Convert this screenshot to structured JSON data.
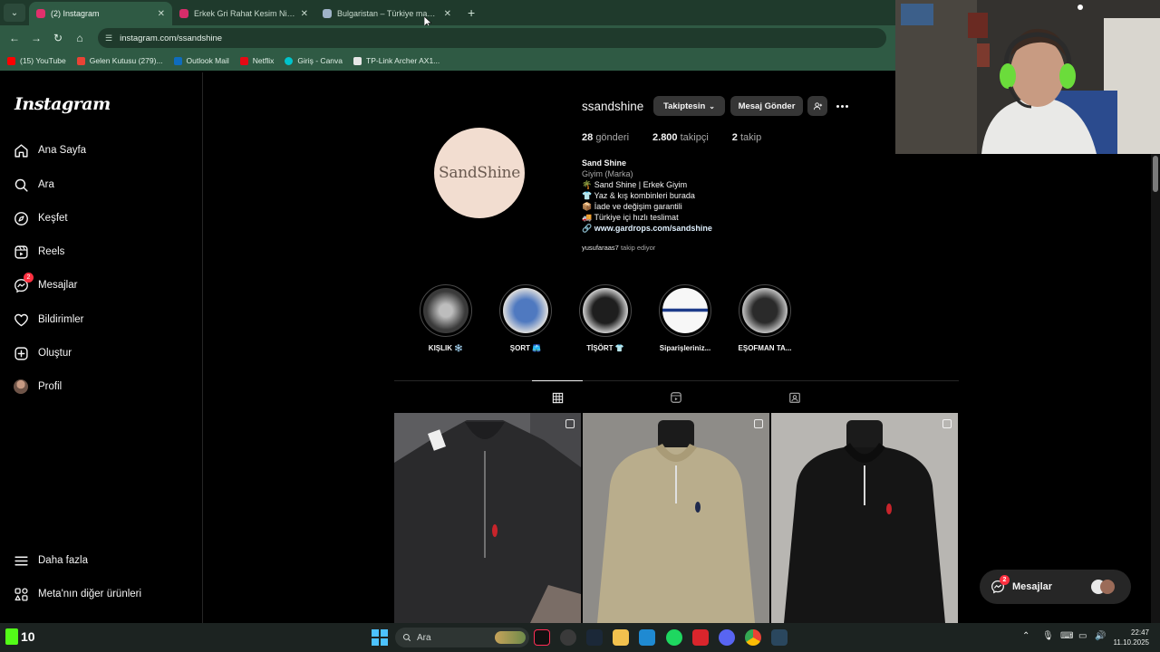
{
  "browser": {
    "tabs": [
      {
        "title": "(2) Instagram",
        "active": true,
        "favicon_color": "#e1306c"
      },
      {
        "title": "Erkek Gri Rahat Kesim Nike Eşo",
        "active": false,
        "favicon_color": "#d62d6a"
      },
      {
        "title": "Bulgaristan – Türkiye maçı canlı",
        "active": false,
        "favicon_color": "#9fb3c8"
      }
    ],
    "new_tab": "+",
    "url": "instagram.com/ssandshine",
    "bookmarks": [
      {
        "label": "(15) YouTube",
        "color": "#ff0000"
      },
      {
        "label": "Gelen Kutusu (279)...",
        "color": "#ea4335"
      },
      {
        "label": "Outlook Mail",
        "color": "#0f6cbd"
      },
      {
        "label": "Netflix",
        "color": "#e50914"
      },
      {
        "label": "Giriş - Canva",
        "color": "#00c4cc"
      },
      {
        "label": "TP-Link Archer AX1...",
        "color": "#e6e6e6"
      }
    ]
  },
  "sidebar": {
    "logo": "Instagram",
    "items": [
      {
        "label": "Ana Sayfa",
        "icon": "home-icon"
      },
      {
        "label": "Ara",
        "icon": "search-icon"
      },
      {
        "label": "Keşfet",
        "icon": "compass-icon"
      },
      {
        "label": "Reels",
        "icon": "reels-icon"
      },
      {
        "label": "Mesajlar",
        "icon": "messenger-icon",
        "badge": "2"
      },
      {
        "label": "Bildirimler",
        "icon": "heart-icon"
      },
      {
        "label": "Oluştur",
        "icon": "plus-square-icon"
      },
      {
        "label": "Profil",
        "icon": "avatar"
      }
    ],
    "more": "Daha fazla",
    "meta": "Meta'nın diğer ürünleri"
  },
  "profile": {
    "pic_text": "SandShine",
    "username": "ssandshine",
    "follow_button": "Takiptesin",
    "message_button": "Mesaj Gönder",
    "stats": {
      "posts_count": "28",
      "posts_label": "gönderi",
      "followers_count": "2.800",
      "followers_label": "takipçi",
      "following_count": "2",
      "following_label": "takip"
    },
    "bio": {
      "name": "Sand Shine",
      "category": "Giyim (Marka)",
      "lines": [
        "🌴 Sand Shine | Erkek Giyim",
        "👕 Yaz & kış kombinleri burada",
        "📦 İade ve değişim garantili",
        "🚚 Türkiye içi hızlı teslimat"
      ],
      "link": "🔗 www.gardrops.com/sandshine"
    },
    "followed_by_user": "yusufaraas7",
    "followed_by_text": "takip ediyor"
  },
  "highlights": [
    {
      "label": "KIŞLIK ❄️",
      "color": "#3a3a3a"
    },
    {
      "label": "ŞORT 🩳",
      "color": "#2c4f8a"
    },
    {
      "label": "TİŞÖRT 👕",
      "color": "#1e1e1e"
    },
    {
      "label": "Siparişleriniz...",
      "color": "#f0f0f0"
    },
    {
      "label": "EŞOFMAN TA...",
      "color": "#2a2a2a"
    }
  ],
  "profile_tabs": [
    {
      "name": "grid-icon",
      "active": true
    },
    {
      "name": "reels-icon",
      "active": false
    },
    {
      "name": "tagged-icon",
      "active": false
    }
  ],
  "posts": [
    {
      "sweater_color": "#2a2a2c",
      "bg": "#5d5d60",
      "logo_color": "#c8242b"
    },
    {
      "sweater_color": "#b9ad8c",
      "bg": "#8e8c88",
      "logo_color": "#1f2a4d"
    },
    {
      "sweater_color": "#151515",
      "bg": "#b8b6b2",
      "logo_color": "#c8242b"
    }
  ],
  "chat": {
    "label": "Mesajlar",
    "badge": "2"
  },
  "taskbar": {
    "widget_value": "10",
    "search_label": "Ara",
    "time": "22:47",
    "date": "11.10.2025"
  }
}
